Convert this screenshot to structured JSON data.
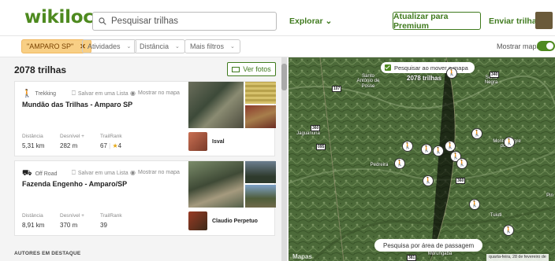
{
  "header": {
    "logo": "wikiloc",
    "search_placeholder": "Pesquisar trilhas",
    "explore": "Explorar ⌄",
    "premium": "Atualizar para Premium",
    "send": "Enviar trilhas"
  },
  "filters": {
    "active_chip": "\"AMPARO SP\"",
    "remove": "✕",
    "chips": [
      "Atividades",
      "Distância",
      "Mais filtros"
    ],
    "chevron": "⌄",
    "show_map": "Mostrar mapa"
  },
  "list": {
    "count": "2078 trilhas",
    "photos_button": "Ver fotos",
    "featured_authors": "AUTORES EM DESTAQUE",
    "cards": [
      {
        "type": "Trekking",
        "save": "Salvar em uma Lista",
        "show_map": "Mostrar no mapa",
        "title": "Mundão das Trilhas - Amparo SP",
        "distance_label": "Distância",
        "distance": "5,31 km",
        "elevation_label": "Desnível +",
        "elevation": "282 m",
        "rank_label": "TrailRank",
        "rank": "67",
        "rating": "4",
        "user": "Isval"
      },
      {
        "type": "Off Road",
        "save": "Salvar em uma Lista",
        "show_map": "Mostrar no mapa",
        "title": "Fazenda Engenho - Amparo/SP",
        "distance_label": "Distância",
        "distance": "8,91 km",
        "elevation_label": "Desnível +",
        "elevation": "370 m",
        "rank_label": "TrailRank",
        "rank": "39",
        "user": "Claudio Perpetuo"
      }
    ]
  },
  "map": {
    "search_on_move": "Pesquisar ao mover o mapa",
    "trail_count": "2078 trilhas",
    "area_search": "Pesquisa por área de passagem",
    "date": "quarta-feira, 28 de fevereiro de",
    "attribution": "Mapas",
    "places": [
      "Santo Antônio de Posse",
      "Serra Negra",
      "Jaguariúna",
      "Pedreira",
      "Monte Alegre do Sul",
      "Tuiuti",
      "Morungaba",
      "Pin"
    ],
    "roads": [
      "107",
      "360",
      "340",
      "095",
      "360",
      "381"
    ],
    "icon_symbol": "🚶"
  },
  "colors": {
    "brand": "#4e8a1f",
    "chip_active": "#f8cf85"
  }
}
